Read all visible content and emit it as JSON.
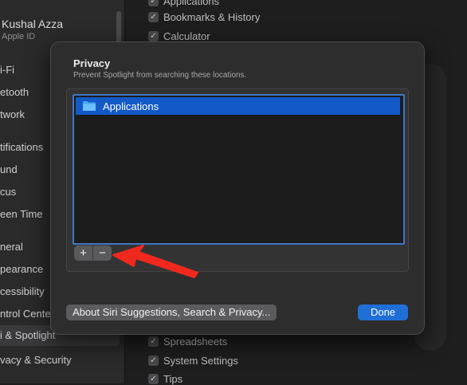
{
  "background": {
    "user": {
      "name": "Kushal Azza",
      "subtitle": "Apple ID"
    },
    "sidebar_items": [
      "i-Fi",
      "etooth",
      "twork",
      "tifications",
      "und",
      "cus",
      "een Time",
      "neral",
      "pearance",
      "cessibility",
      "ntrol Cente",
      "i & Spotlight",
      "vacy & Security"
    ],
    "selected_sidebar_index": 11,
    "checkbox_rows_top": [
      "Applications",
      "Bookmarks & History",
      "Calculator"
    ],
    "checkbox_rows_bottom": [
      "Spreadsheets",
      "System Settings",
      "Tips"
    ]
  },
  "sheet": {
    "title": "Privacy",
    "subtitle": "Prevent Spotlight from searching these locations.",
    "list_items": [
      {
        "label": "Applications",
        "icon": "folder-icon",
        "selected": true
      }
    ],
    "add_label": "+",
    "remove_label": "−",
    "about_label": "About Siri Suggestions, Search & Privacy...",
    "done_label": "Done"
  },
  "colors": {
    "accent": "#1f6fd6",
    "selection": "#1359c8",
    "annotation_arrow": "#f0281e"
  }
}
